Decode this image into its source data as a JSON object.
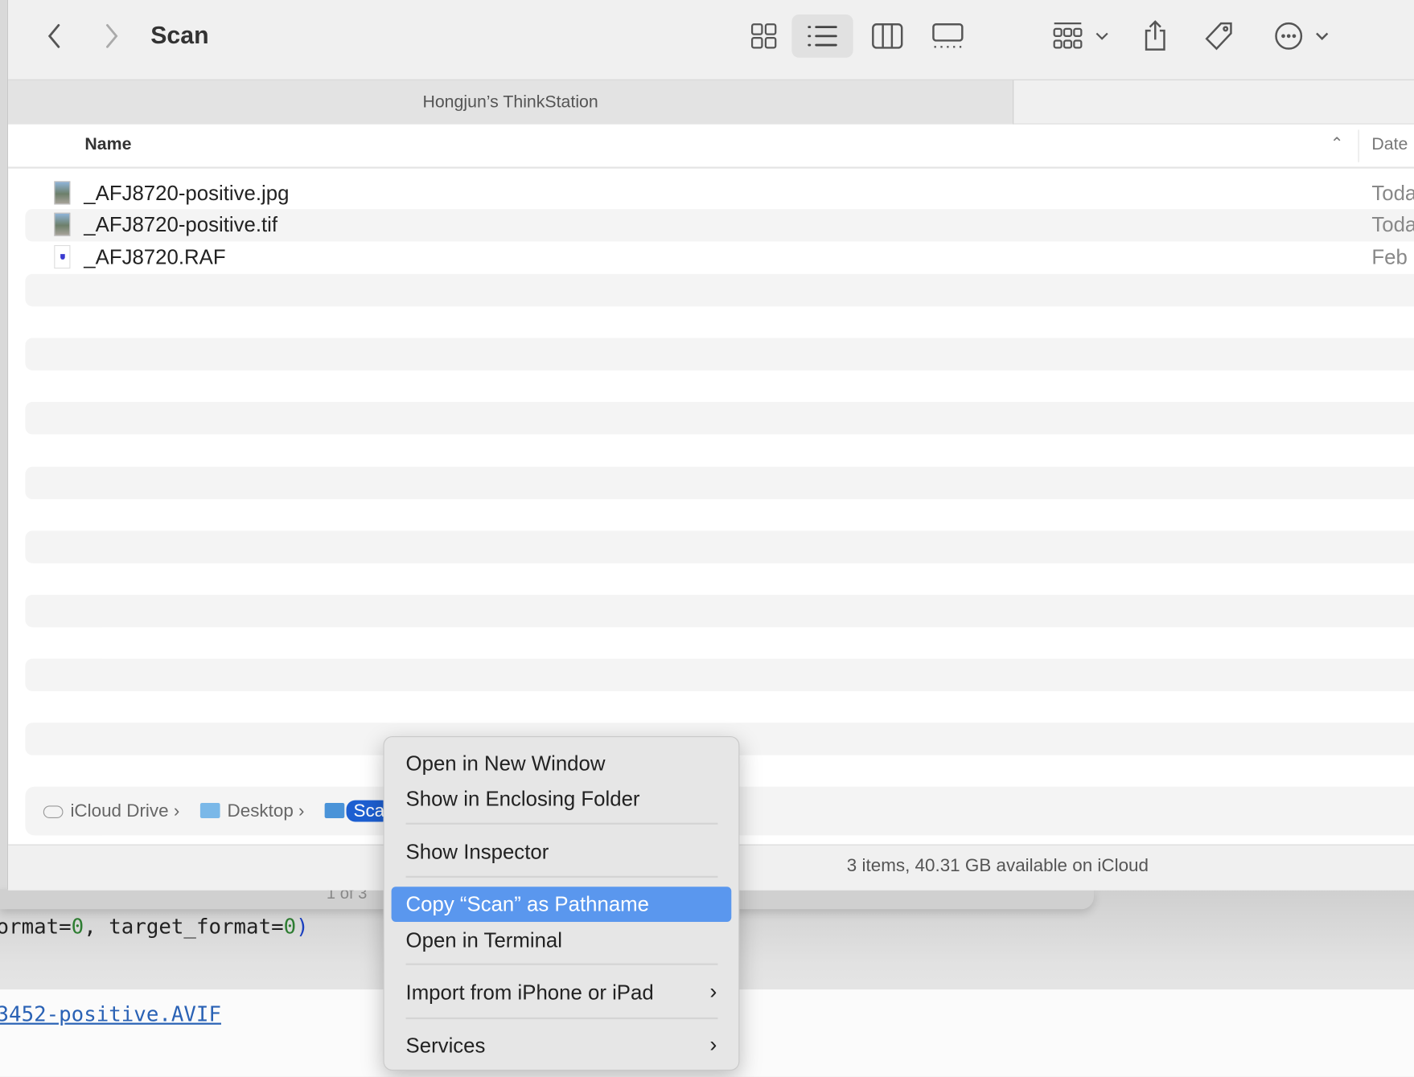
{
  "toolbar": {
    "title": "Scan",
    "icons": [
      "chevron-left-icon",
      "chevron-right-icon",
      "icon-view-icon",
      "list-view-icon",
      "column-view-icon",
      "gallery-view-icon",
      "group-icon",
      "share-icon",
      "tag-icon",
      "more-icon"
    ],
    "active_view": "list"
  },
  "tab": {
    "label": "Hongjun’s ThinkStation"
  },
  "columns": {
    "name": "Name",
    "date": "Date"
  },
  "files": [
    {
      "name": "_AFJ8720-positive.jpg",
      "date": "Toda",
      "kind": "image"
    },
    {
      "name": "_AFJ8720-positive.tif",
      "date": "Toda",
      "kind": "image"
    },
    {
      "name": "_AFJ8720.RAF",
      "date": "Feb",
      "kind": "raw"
    }
  ],
  "pathbar": {
    "items": [
      "iCloud Drive",
      "Desktop",
      "Sca"
    ],
    "separator": "›"
  },
  "status": "3 items, 40.31 GB available on iCloud",
  "background": {
    "counter": "1 of 3",
    "code_line": {
      "a": "ormat=",
      "n1": "0",
      "b": ", target_format=",
      "n2": "0",
      "c": ")"
    },
    "link": "3452-positive.AVIF"
  },
  "context_menu": {
    "items": [
      {
        "label": "Open in New Window"
      },
      {
        "label": "Show in Enclosing Folder"
      },
      {
        "label": "Show Inspector"
      },
      {
        "label": "Copy “Scan” as Pathname",
        "highlighted": true
      },
      {
        "label": "Open in Terminal"
      },
      {
        "label": "Import from iPhone or iPad",
        "submenu": "›"
      },
      {
        "label": "Services",
        "submenu": "›"
      }
    ]
  },
  "colors": {
    "highlight": "#5a97ee",
    "path_pill": "#1d5fd1",
    "link": "#2a62b5"
  }
}
